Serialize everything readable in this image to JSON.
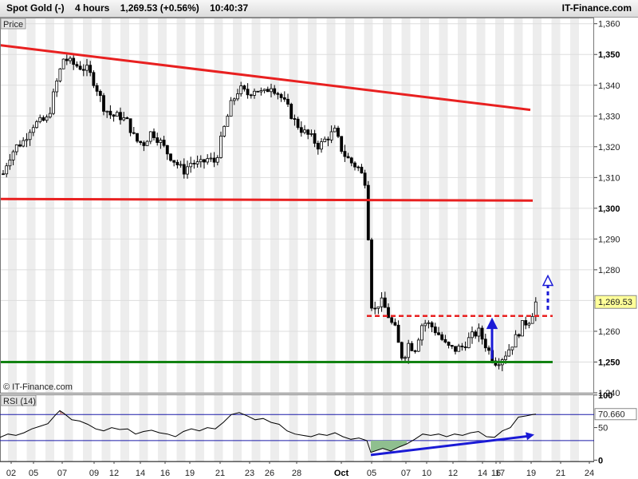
{
  "header": {
    "instrument": "Spot Gold (-)",
    "timeframe": "4 hours",
    "price_change": "1,269.53 (+0.56%)",
    "time": "10:40:37",
    "brand": "IT-Finance.com"
  },
  "labels": {
    "price_tab": "Price",
    "rsi_tab": "RSI (14)",
    "copyright": "© IT-Finance.com"
  },
  "colors": {
    "resistance": "#e82020",
    "support": "#128212",
    "arrows": "#1a1ad6",
    "rsi_overbought_fill": "#c99a9a",
    "rsi_oversold_fill": "#8fbf8f",
    "price_marker": "#ffff99"
  },
  "chart_data": [
    {
      "type": "candlestick",
      "panel": "price",
      "ylim": [
        1240,
        1362
      ],
      "y_ticks": [
        "1,360",
        "1,350",
        "1,340",
        "1,330",
        "1,320",
        "1,310",
        "1,300",
        "1,290",
        "1,280",
        "1,270",
        "1,260",
        "1,250",
        "1,240"
      ],
      "bold_ticks": [
        "1,350",
        "1,300",
        "1,250"
      ],
      "x_labels": [
        "02",
        "05",
        "07",
        "09",
        "12",
        "14",
        "16",
        "19",
        "21",
        "23",
        "26",
        "28",
        "Oct",
        "05",
        "07",
        "10",
        "12",
        "14",
        "16",
        "17",
        "19",
        "21",
        "24"
      ],
      "current_price": "1,269.53",
      "close_path": [
        [
          0,
          1308
        ],
        [
          10,
          1316
        ],
        [
          20,
          1320
        ],
        [
          30,
          1322
        ],
        [
          40,
          1327
        ],
        [
          50,
          1328
        ],
        [
          60,
          1329
        ],
        [
          70,
          1340
        ],
        [
          80,
          1349
        ],
        [
          90,
          1347
        ],
        [
          100,
          1346
        ],
        [
          110,
          1345
        ],
        [
          120,
          1340
        ],
        [
          130,
          1333
        ],
        [
          140,
          1330
        ],
        [
          150,
          1330
        ],
        [
          160,
          1328
        ],
        [
          170,
          1322
        ],
        [
          180,
          1321
        ],
        [
          190,
          1325
        ],
        [
          200,
          1322
        ],
        [
          210,
          1318
        ],
        [
          220,
          1315
        ],
        [
          230,
          1312
        ],
        [
          240,
          1315
        ],
        [
          250,
          1314
        ],
        [
          260,
          1316
        ],
        [
          270,
          1315
        ],
        [
          280,
          1325
        ],
        [
          290,
          1334
        ],
        [
          300,
          1339
        ],
        [
          310,
          1337
        ],
        [
          320,
          1339
        ],
        [
          330,
          1337
        ],
        [
          340,
          1340
        ],
        [
          350,
          1337
        ],
        [
          360,
          1333
        ],
        [
          370,
          1328
        ],
        [
          380,
          1325
        ],
        [
          390,
          1323
        ],
        [
          400,
          1320
        ],
        [
          410,
          1323
        ],
        [
          420,
          1325
        ],
        [
          430,
          1318
        ],
        [
          440,
          1315
        ],
        [
          450,
          1313
        ],
        [
          455,
          1310
        ],
        [
          460,
          1308
        ],
        [
          463,
          1280
        ],
        [
          467,
          1265
        ],
        [
          472,
          1268
        ],
        [
          477,
          1270
        ],
        [
          482,
          1268
        ],
        [
          487,
          1265
        ],
        [
          492,
          1262
        ],
        [
          497,
          1260
        ],
        [
          502,
          1252
        ],
        [
          507,
          1252
        ],
        [
          512,
          1256
        ],
        [
          520,
          1254
        ],
        [
          530,
          1263
        ],
        [
          540,
          1262
        ],
        [
          550,
          1259
        ],
        [
          560,
          1255
        ],
        [
          570,
          1254
        ],
        [
          580,
          1255
        ],
        [
          590,
          1258
        ],
        [
          600,
          1260
        ],
        [
          610,
          1255
        ],
        [
          616,
          1252
        ],
        [
          622,
          1250
        ],
        [
          628,
          1251
        ],
        [
          635,
          1253
        ],
        [
          645,
          1257
        ],
        [
          655,
          1262
        ],
        [
          665,
          1264
        ],
        [
          672,
          1269.5
        ]
      ],
      "trendlines": [
        {
          "role": "resistance-descending",
          "from": [
            0,
            1353
          ],
          "to": [
            665,
            1332
          ]
        },
        {
          "role": "support-upper",
          "from": [
            0,
            1303
          ],
          "to": [
            668,
            1302.5
          ]
        },
        {
          "role": "support-lower",
          "from": [
            0,
            1250
          ],
          "to": [
            693,
            1250
          ]
        },
        {
          "role": "breakout-level-dashed",
          "from": [
            460,
            1265
          ],
          "to": [
            693,
            1265
          ]
        }
      ],
      "arrows": [
        {
          "role": "measured-move-solid",
          "x": 617,
          "from": 1251,
          "to": 1263
        },
        {
          "role": "projection-dashed",
          "x": 687,
          "from": 1267,
          "to": 1277
        }
      ]
    },
    {
      "type": "line",
      "panel": "rsi",
      "name": "RSI (14)",
      "ylim": [
        -2,
        101
      ],
      "y_ticks": [
        "100",
        "50",
        "0"
      ],
      "levels": [
        70,
        30
      ],
      "current_value": "70.660",
      "path": [
        [
          0,
          35
        ],
        [
          10,
          40
        ],
        [
          20,
          38
        ],
        [
          30,
          42
        ],
        [
          40,
          48
        ],
        [
          50,
          52
        ],
        [
          60,
          56
        ],
        [
          70,
          70
        ],
        [
          75,
          76
        ],
        [
          80,
          72
        ],
        [
          90,
          62
        ],
        [
          100,
          60
        ],
        [
          110,
          55
        ],
        [
          120,
          48
        ],
        [
          130,
          45
        ],
        [
          140,
          50
        ],
        [
          150,
          47
        ],
        [
          160,
          48
        ],
        [
          170,
          40
        ],
        [
          180,
          44
        ],
        [
          190,
          46
        ],
        [
          200,
          42
        ],
        [
          210,
          40
        ],
        [
          220,
          36
        ],
        [
          230,
          44
        ],
        [
          240,
          48
        ],
        [
          250,
          45
        ],
        [
          260,
          50
        ],
        [
          270,
          48
        ],
        [
          280,
          58
        ],
        [
          290,
          70
        ],
        [
          300,
          73
        ],
        [
          310,
          68
        ],
        [
          320,
          62
        ],
        [
          330,
          64
        ],
        [
          340,
          58
        ],
        [
          350,
          55
        ],
        [
          360,
          45
        ],
        [
          370,
          40
        ],
        [
          380,
          38
        ],
        [
          390,
          36
        ],
        [
          400,
          40
        ],
        [
          410,
          38
        ],
        [
          420,
          42
        ],
        [
          430,
          36
        ],
        [
          440,
          32
        ],
        [
          450,
          34
        ],
        [
          460,
          30
        ],
        [
          465,
          12
        ],
        [
          470,
          14
        ],
        [
          480,
          18
        ],
        [
          490,
          14
        ],
        [
          500,
          20
        ],
        [
          510,
          25
        ],
        [
          520,
          32
        ],
        [
          530,
          40
        ],
        [
          540,
          38
        ],
        [
          550,
          40
        ],
        [
          560,
          36
        ],
        [
          570,
          40
        ],
        [
          580,
          38
        ],
        [
          590,
          42
        ],
        [
          600,
          44
        ],
        [
          610,
          36
        ],
        [
          620,
          35
        ],
        [
          630,
          45
        ],
        [
          640,
          50
        ],
        [
          650,
          66
        ],
        [
          660,
          68
        ],
        [
          668,
          70
        ],
        [
          672,
          70.7
        ]
      ],
      "trendline": {
        "from": [
          465,
          8
        ],
        "to": [
          668,
          38
        ]
      }
    }
  ]
}
